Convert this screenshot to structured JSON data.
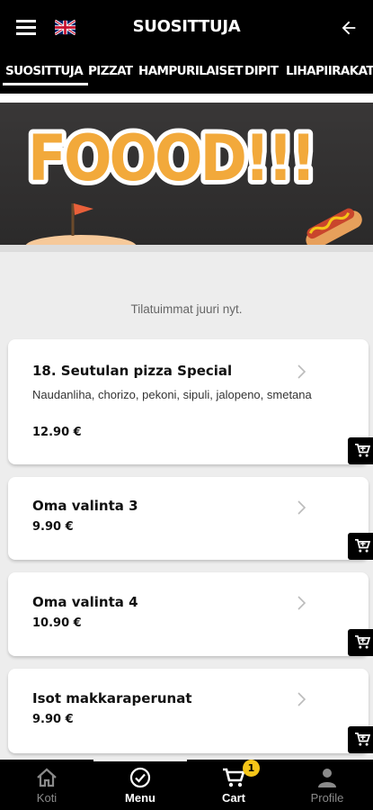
{
  "header": {
    "title": "SUOSITTUJA"
  },
  "tabs": [
    "SUOSITTUJA",
    "PIZZAT",
    "HAMPURILAISET",
    "DIPIT",
    "LIHAPIIRAKAT"
  ],
  "banner": {
    "text": "FOOOD!!!"
  },
  "subtitle": "Tilatuimmat juuri nyt.",
  "items": [
    {
      "name": "18. Seutulan pizza Special",
      "desc": "Naudanliha, chorizo, pekoni, sipuli, jalopeno, smetana",
      "price": "12.90 €"
    },
    {
      "name": "Oma valinta 3",
      "desc": "",
      "price": "9.90 €"
    },
    {
      "name": "Oma valinta 4",
      "desc": "",
      "price": "10.90 €"
    },
    {
      "name": "Isot makkaraperunat",
      "desc": "",
      "price": "9.90 €"
    }
  ],
  "nav": [
    {
      "label": "Koti",
      "icon": "home-icon"
    },
    {
      "label": "Menu",
      "icon": "check-circle-icon"
    },
    {
      "label": "Cart",
      "icon": "cart-icon",
      "badge": "1"
    },
    {
      "label": "Profile",
      "icon": "person-icon"
    }
  ],
  "colors": {
    "bar": "#000000",
    "badge": "#f5c518",
    "banner_text": "#f2a93b"
  }
}
